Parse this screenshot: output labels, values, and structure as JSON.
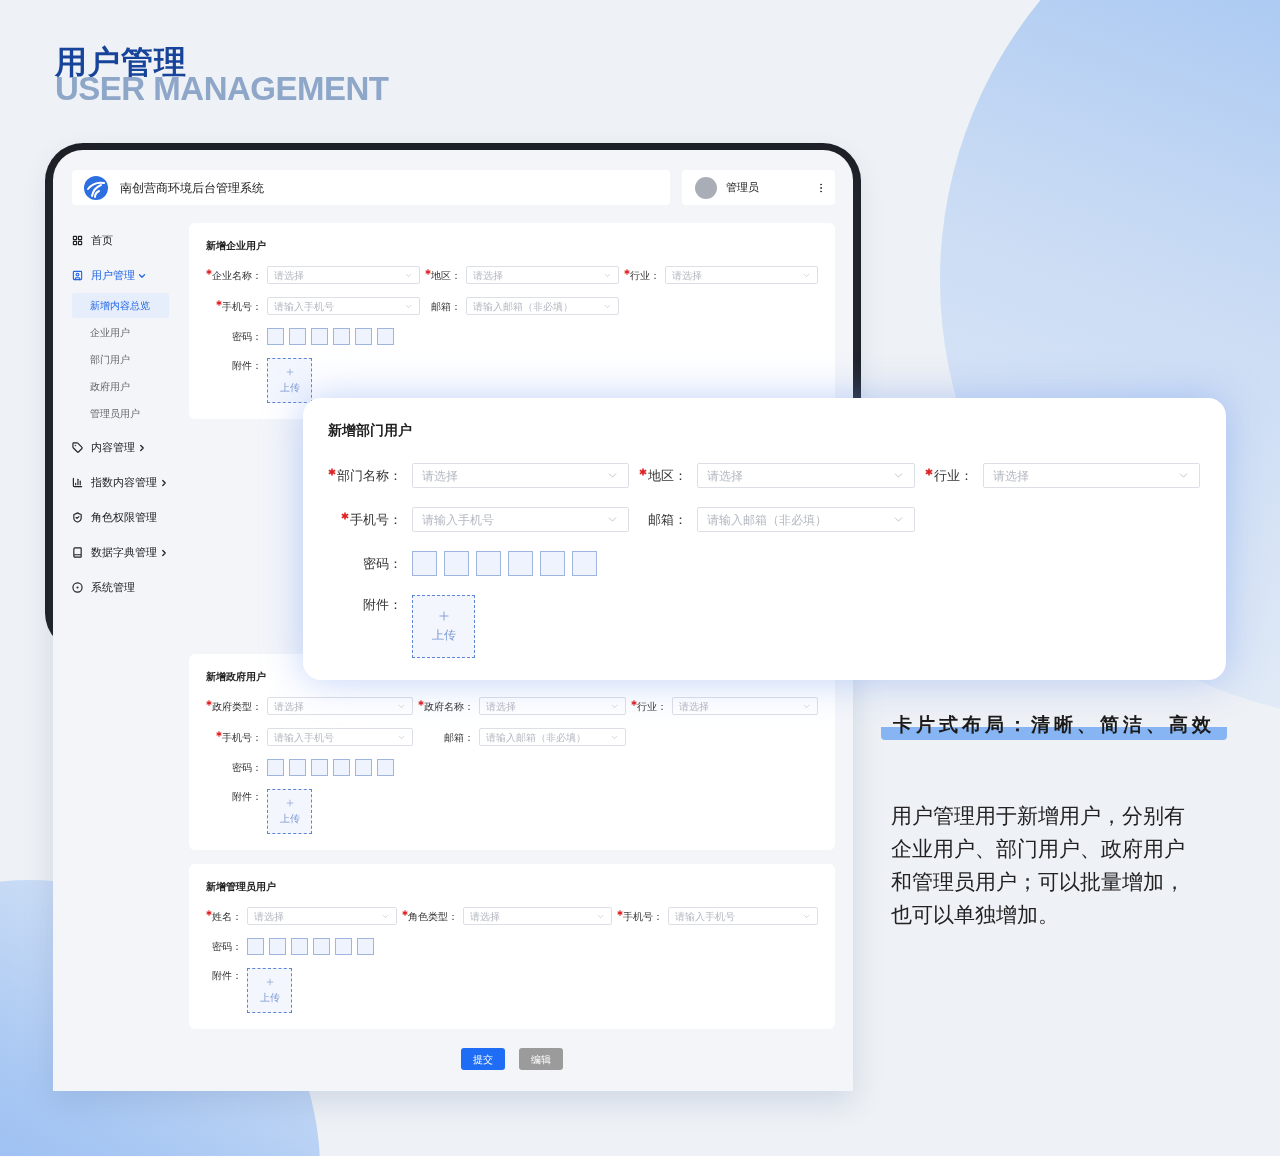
{
  "page_title": {
    "title": "用户管理",
    "subtitle": "USER MANAGEMENT"
  },
  "app": {
    "system_name": "南创营商环境后台管理系统",
    "user": "管理员",
    "sidebar": [
      {
        "label": "首页",
        "selected": false
      },
      {
        "label": "用户管理",
        "selected": true,
        "expanded": true,
        "children": [
          {
            "label": "新增内容总览",
            "selected": true
          },
          {
            "label": "企业用户",
            "selected": false
          },
          {
            "label": "部门用户",
            "selected": false
          },
          {
            "label": "政府用户",
            "selected": false
          },
          {
            "label": "管理员用户",
            "selected": false
          }
        ]
      },
      {
        "label": "内容管理",
        "selected": false,
        "expanded": false
      },
      {
        "label": "指数内容管理",
        "selected": false,
        "expanded": false
      },
      {
        "label": "角色权限管理",
        "selected": false
      },
      {
        "label": "数据字典管理",
        "selected": false,
        "expanded": false
      },
      {
        "label": "系统管理",
        "selected": false
      }
    ],
    "forms": [
      {
        "title": "新增企业用户",
        "rows": [
          [
            {
              "label": "企业名称：",
              "required": true,
              "placeholder": "请选择"
            },
            {
              "label": "地区：",
              "required": true,
              "placeholder": "请选择"
            },
            {
              "label": "行业：",
              "required": true,
              "placeholder": "请选择"
            }
          ],
          [
            {
              "label": "手机号：",
              "required": true,
              "placeholder": "请输入手机号"
            },
            {
              "label": "邮箱：",
              "required": false,
              "placeholder": "请输入邮箱（非必填）"
            }
          ]
        ],
        "password_label": "密码：",
        "attachment_label": "附件：",
        "upload": "上传"
      },
      {
        "title": "新增政府用户",
        "rows": [
          [
            {
              "label": "政府类型：",
              "required": true,
              "placeholder": "请选择"
            },
            {
              "label": "政府名称：",
              "required": true,
              "placeholder": "请选择"
            },
            {
              "label": "行业：",
              "required": true,
              "placeholder": "请选择"
            }
          ],
          [
            {
              "label": "手机号：",
              "required": true,
              "placeholder": "请输入手机号"
            },
            {
              "label": "邮箱：",
              "required": false,
              "placeholder": "请输入邮箱（非必填）"
            }
          ]
        ],
        "password_label": "密码：",
        "attachment_label": "附件：",
        "upload": "上传"
      },
      {
        "title": "新增管理员用户",
        "rows": [
          [
            {
              "label": "姓名：",
              "required": true,
              "placeholder": "请选择"
            },
            {
              "label": "角色类型：",
              "required": true,
              "placeholder": "请选择"
            },
            {
              "label": "手机号：",
              "required": true,
              "placeholder": "请输入手机号"
            }
          ]
        ],
        "password_label": "密码：",
        "attachment_label": "附件：",
        "upload": "上传"
      }
    ],
    "buttons": [
      {
        "label": "提交",
        "kind": "primary"
      },
      {
        "label": "编辑",
        "kind": "secondary"
      }
    ]
  },
  "featured_form": {
    "title": "新增部门用户",
    "rows": [
      [
        {
          "label": "部门名称：",
          "required": true,
          "placeholder": "请选择"
        },
        {
          "label": "地区：",
          "required": true,
          "placeholder": "请选择"
        },
        {
          "label": "行业：",
          "required": true,
          "placeholder": "请选择"
        }
      ],
      [
        {
          "label": "手机号：",
          "required": true,
          "placeholder": "请输入手机号"
        },
        {
          "label": "邮箱：",
          "required": false,
          "placeholder": "请输入邮箱（非必填）"
        }
      ]
    ],
    "password_label": "密码：",
    "attachment_label": "附件：",
    "upload": "上传"
  },
  "tagline": "卡片式布局：清晰、简洁、高效",
  "description": "用户管理用于新增用户，分别有企业用户、部门用户、政府用户和管理员用户；可以批量增加，也可以单独增加。"
}
